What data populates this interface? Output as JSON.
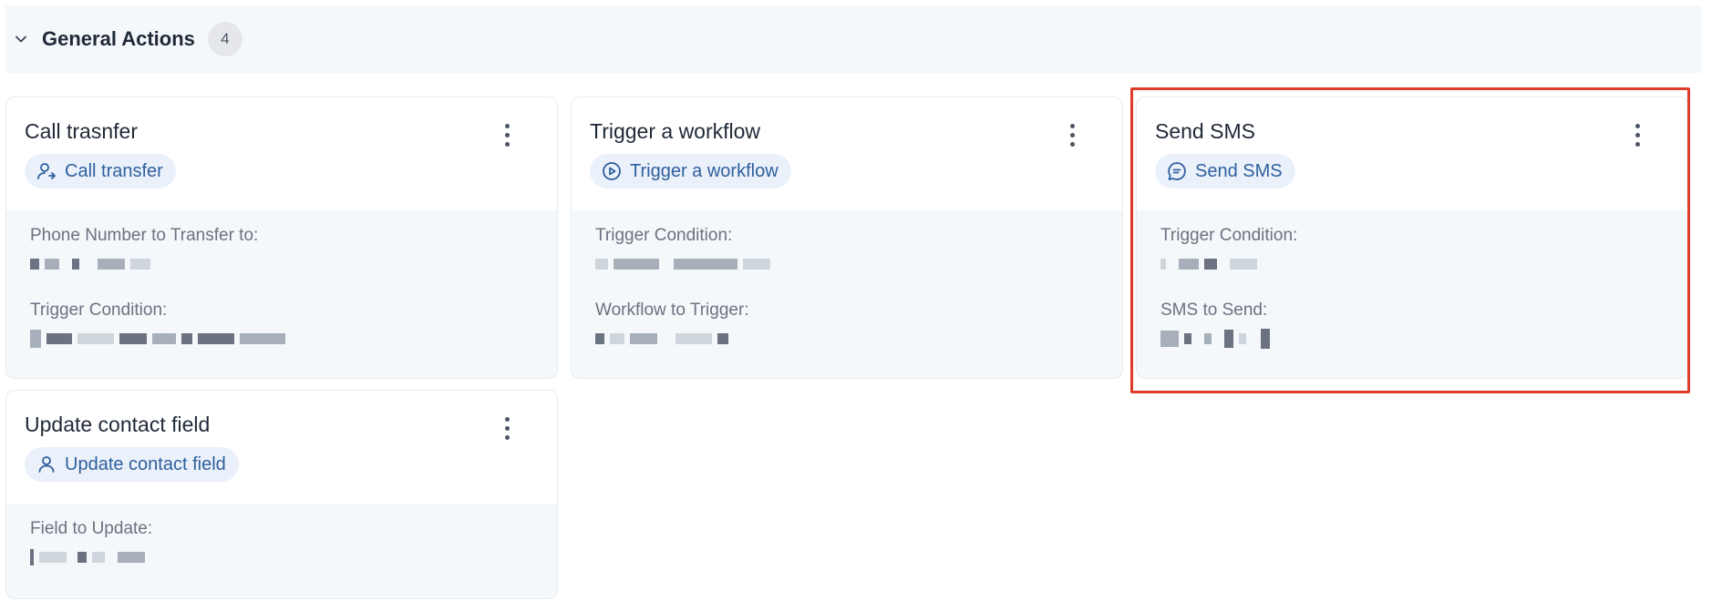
{
  "section": {
    "title": "General Actions",
    "count": "4"
  },
  "cards": [
    {
      "title": "Call trasnfer",
      "pill": "Call transfer",
      "icon": "user-arrow-icon",
      "fields": [
        {
          "label": "Phone Number to Transfer to:"
        },
        {
          "label": "Trigger Condition:"
        }
      ]
    },
    {
      "title": "Trigger a workflow",
      "pill": "Trigger a workflow",
      "icon": "play-circle-icon",
      "fields": [
        {
          "label": "Trigger Condition:"
        },
        {
          "label": "Workflow to Trigger:"
        }
      ]
    },
    {
      "title": "Send SMS",
      "pill": "Send SMS",
      "icon": "message-icon",
      "fields": [
        {
          "label": "Trigger Condition:"
        },
        {
          "label": "SMS to Send:"
        }
      ]
    },
    {
      "title": "Update contact field",
      "pill": "Update contact field",
      "icon": "user-icon",
      "fields": [
        {
          "label": "Field to Update:"
        }
      ]
    }
  ],
  "colors": {
    "accent": "#2f5f9e",
    "highlight": "#e03b2a"
  }
}
